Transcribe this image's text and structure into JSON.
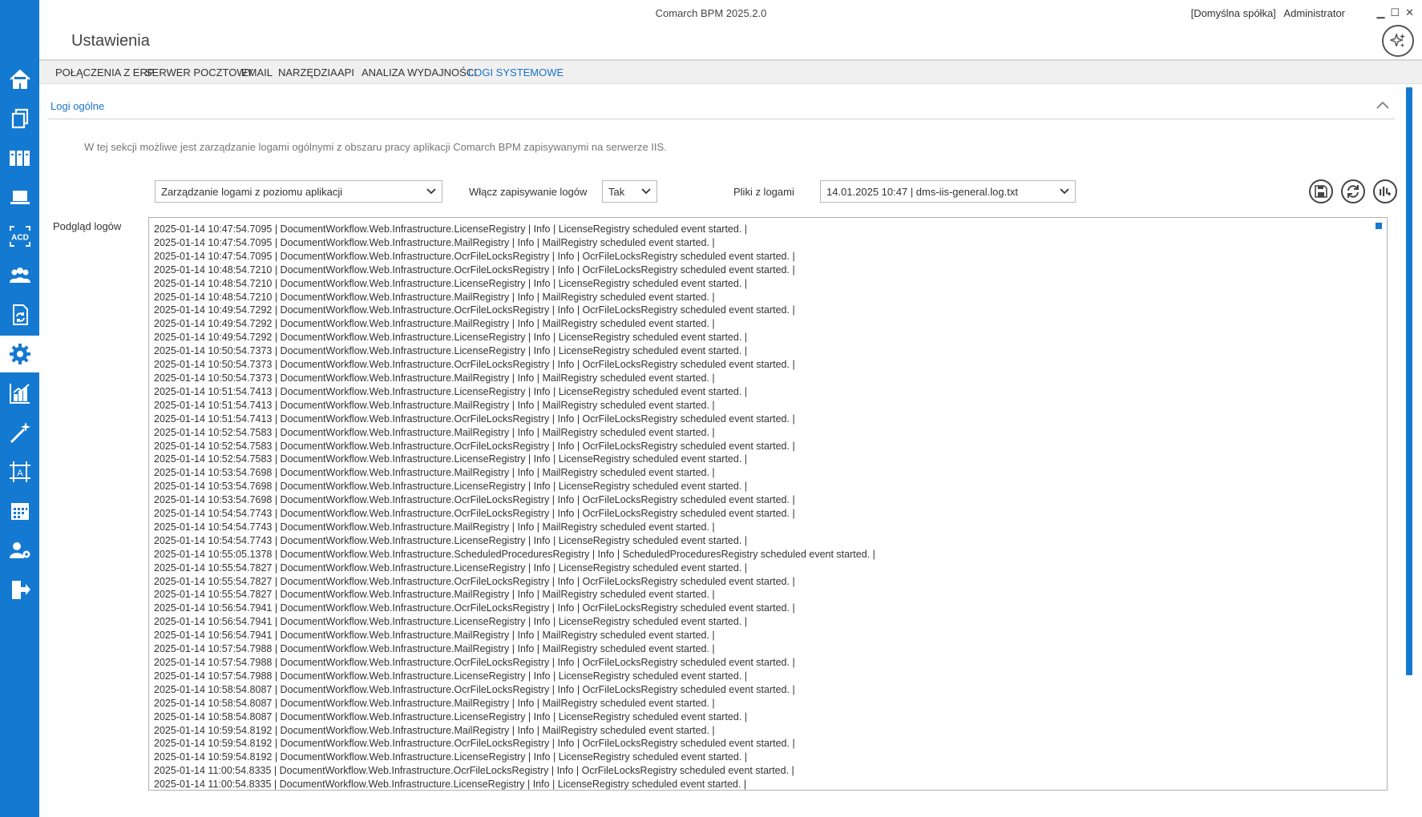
{
  "window": {
    "app_title": "Comarch BPM 2025.2.0",
    "company": "[Domyślna spółka]",
    "user": "Administrator",
    "minimize": "▁",
    "maximize": "☐",
    "close": "✕"
  },
  "page": {
    "title": "Ustawienia"
  },
  "tabs": [
    {
      "label": "POŁĄCZENIA Z ERP"
    },
    {
      "label": "SERWER POCZTOWY"
    },
    {
      "label": "EMAIL"
    },
    {
      "label": "NARZĘDZIA"
    },
    {
      "label": "API"
    },
    {
      "label": "ANALIZA WYDAJNOŚCI"
    },
    {
      "label": "LOGI SYSTEMOWE"
    }
  ],
  "section": {
    "title": "Logi ogólne",
    "description": "W tej sekcji możliwe jest zarządzanie logami ogólnymi z obszaru pracy aplikacji Comarch BPM zapisywanymi na serwerze IIS."
  },
  "controls": {
    "mode_select": "Zarządzanie logami z poziomu aplikacji",
    "enable_label": "Włącz zapisywanie logów",
    "enable_value": "Tak",
    "files_label": "Pliki z logami",
    "files_value": "14.01.2025 10:47 | dms-iis-general.log.txt",
    "preview_label": "Podgląd logów"
  },
  "sidebar_icons": [
    "home-icon",
    "documents-icon",
    "archive-icon",
    "laptop-icon",
    "acd-icon",
    "users-icon",
    "document-sync-icon",
    "settings-icon",
    "analytics-icon",
    "wand-icon",
    "designer-icon",
    "calendar-icon",
    "user-settings-icon",
    "logout-icon"
  ],
  "accent_color": "#1479d1",
  "log_lines": [
    "2025-01-14 10:47:54.7095 | DocumentWorkflow.Web.Infrastructure.LicenseRegistry | Info | LicenseRegistry scheduled event started. |",
    "2025-01-14 10:47:54.7095 | DocumentWorkflow.Web.Infrastructure.MailRegistry | Info | MailRegistry scheduled event started. |",
    "2025-01-14 10:47:54.7095 | DocumentWorkflow.Web.Infrastructure.OcrFileLocksRegistry | Info | OcrFileLocksRegistry scheduled event started. |",
    "2025-01-14 10:48:54.7210 | DocumentWorkflow.Web.Infrastructure.OcrFileLocksRegistry | Info | OcrFileLocksRegistry scheduled event started. |",
    "2025-01-14 10:48:54.7210 | DocumentWorkflow.Web.Infrastructure.LicenseRegistry | Info | LicenseRegistry scheduled event started. |",
    "2025-01-14 10:48:54.7210 | DocumentWorkflow.Web.Infrastructure.MailRegistry | Info | MailRegistry scheduled event started. |",
    "2025-01-14 10:49:54.7292 | DocumentWorkflow.Web.Infrastructure.OcrFileLocksRegistry | Info | OcrFileLocksRegistry scheduled event started. |",
    "2025-01-14 10:49:54.7292 | DocumentWorkflow.Web.Infrastructure.MailRegistry | Info | MailRegistry scheduled event started. |",
    "2025-01-14 10:49:54.7292 | DocumentWorkflow.Web.Infrastructure.LicenseRegistry | Info | LicenseRegistry scheduled event started. |",
    "2025-01-14 10:50:54.7373 | DocumentWorkflow.Web.Infrastructure.LicenseRegistry | Info | LicenseRegistry scheduled event started. |",
    "2025-01-14 10:50:54.7373 | DocumentWorkflow.Web.Infrastructure.OcrFileLocksRegistry | Info | OcrFileLocksRegistry scheduled event started. |",
    "2025-01-14 10:50:54.7373 | DocumentWorkflow.Web.Infrastructure.MailRegistry | Info | MailRegistry scheduled event started. |",
    "2025-01-14 10:51:54.7413 | DocumentWorkflow.Web.Infrastructure.LicenseRegistry | Info | LicenseRegistry scheduled event started. |",
    "2025-01-14 10:51:54.7413 | DocumentWorkflow.Web.Infrastructure.MailRegistry | Info | MailRegistry scheduled event started. |",
    "2025-01-14 10:51:54.7413 | DocumentWorkflow.Web.Infrastructure.OcrFileLocksRegistry | Info | OcrFileLocksRegistry scheduled event started. |",
    "2025-01-14 10:52:54.7583 | DocumentWorkflow.Web.Infrastructure.MailRegistry | Info | MailRegistry scheduled event started. |",
    "2025-01-14 10:52:54.7583 | DocumentWorkflow.Web.Infrastructure.OcrFileLocksRegistry | Info | OcrFileLocksRegistry scheduled event started. |",
    "2025-01-14 10:52:54.7583 | DocumentWorkflow.Web.Infrastructure.LicenseRegistry | Info | LicenseRegistry scheduled event started. |",
    "2025-01-14 10:53:54.7698 | DocumentWorkflow.Web.Infrastructure.MailRegistry | Info | MailRegistry scheduled event started. |",
    "2025-01-14 10:53:54.7698 | DocumentWorkflow.Web.Infrastructure.LicenseRegistry | Info | LicenseRegistry scheduled event started. |",
    "2025-01-14 10:53:54.7698 | DocumentWorkflow.Web.Infrastructure.OcrFileLocksRegistry | Info | OcrFileLocksRegistry scheduled event started. |",
    "2025-01-14 10:54:54.7743 | DocumentWorkflow.Web.Infrastructure.OcrFileLocksRegistry | Info | OcrFileLocksRegistry scheduled event started. |",
    "2025-01-14 10:54:54.7743 | DocumentWorkflow.Web.Infrastructure.MailRegistry | Info | MailRegistry scheduled event started. |",
    "2025-01-14 10:54:54.7743 | DocumentWorkflow.Web.Infrastructure.LicenseRegistry | Info | LicenseRegistry scheduled event started. |",
    "2025-01-14 10:55:05.1378 | DocumentWorkflow.Web.Infrastructure.ScheduledProceduresRegistry | Info | ScheduledProceduresRegistry scheduled event started. |",
    "2025-01-14 10:55:54.7827 | DocumentWorkflow.Web.Infrastructure.LicenseRegistry | Info | LicenseRegistry scheduled event started. |",
    "2025-01-14 10:55:54.7827 | DocumentWorkflow.Web.Infrastructure.OcrFileLocksRegistry | Info | OcrFileLocksRegistry scheduled event started. |",
    "2025-01-14 10:55:54.7827 | DocumentWorkflow.Web.Infrastructure.MailRegistry | Info | MailRegistry scheduled event started. |",
    "2025-01-14 10:56:54.7941 | DocumentWorkflow.Web.Infrastructure.OcrFileLocksRegistry | Info | OcrFileLocksRegistry scheduled event started. |",
    "2025-01-14 10:56:54.7941 | DocumentWorkflow.Web.Infrastructure.LicenseRegistry | Info | LicenseRegistry scheduled event started. |",
    "2025-01-14 10:56:54.7941 | DocumentWorkflow.Web.Infrastructure.MailRegistry | Info | MailRegistry scheduled event started. |",
    "2025-01-14 10:57:54.7988 | DocumentWorkflow.Web.Infrastructure.MailRegistry | Info | MailRegistry scheduled event started. |",
    "2025-01-14 10:57:54.7988 | DocumentWorkflow.Web.Infrastructure.OcrFileLocksRegistry | Info | OcrFileLocksRegistry scheduled event started. |",
    "2025-01-14 10:57:54.7988 | DocumentWorkflow.Web.Infrastructure.LicenseRegistry | Info | LicenseRegistry scheduled event started. |",
    "2025-01-14 10:58:54.8087 | DocumentWorkflow.Web.Infrastructure.OcrFileLocksRegistry | Info | OcrFileLocksRegistry scheduled event started. |",
    "2025-01-14 10:58:54.8087 | DocumentWorkflow.Web.Infrastructure.MailRegistry | Info | MailRegistry scheduled event started. |",
    "2025-01-14 10:58:54.8087 | DocumentWorkflow.Web.Infrastructure.LicenseRegistry | Info | LicenseRegistry scheduled event started. |",
    "2025-01-14 10:59:54.8192 | DocumentWorkflow.Web.Infrastructure.MailRegistry | Info | MailRegistry scheduled event started. |",
    "2025-01-14 10:59:54.8192 | DocumentWorkflow.Web.Infrastructure.OcrFileLocksRegistry | Info | OcrFileLocksRegistry scheduled event started. |",
    "2025-01-14 10:59:54.8192 | DocumentWorkflow.Web.Infrastructure.LicenseRegistry | Info | LicenseRegistry scheduled event started. |",
    "2025-01-14 11:00:54.8335 | DocumentWorkflow.Web.Infrastructure.OcrFileLocksRegistry | Info | OcrFileLocksRegistry scheduled event started. |",
    "2025-01-14 11:00:54.8335 | DocumentWorkflow.Web.Infrastructure.LicenseRegistry | Info | LicenseRegistry scheduled event started. |"
  ]
}
